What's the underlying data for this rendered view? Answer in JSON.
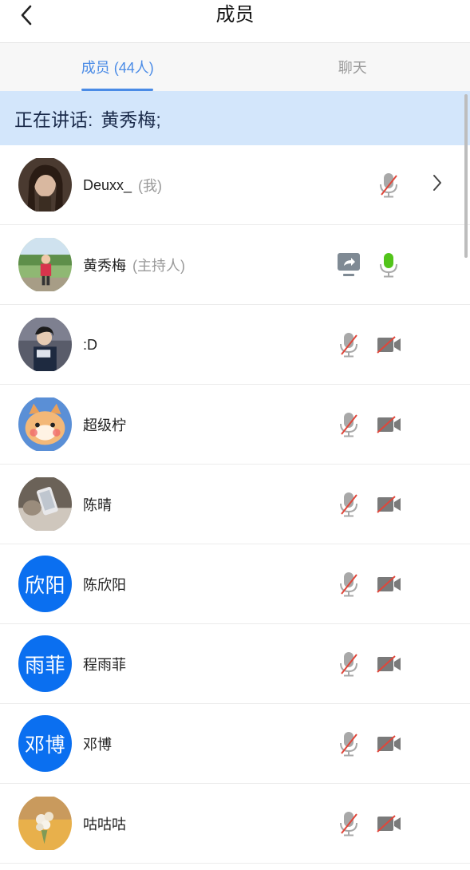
{
  "header": {
    "title": "成员",
    "back_icon": "chevron-left-icon"
  },
  "tabs": [
    {
      "label": "成员 (44人)",
      "active": true
    },
    {
      "label": "聊天",
      "active": false
    }
  ],
  "banner": {
    "prefix": "正在讲话:",
    "speaker": "黄秀梅;"
  },
  "colors": {
    "accent": "#4a8be6",
    "banner_bg": "#d3e6fb",
    "avatar_blue": "#0a6ff0",
    "mic_active": "#52c41a",
    "muted_red": "#e0463a"
  },
  "members": [
    {
      "name": "Deuxx_",
      "role": "(我)",
      "avatar_type": "photo",
      "avatar_icon": "girl-portrait-photo",
      "mic": "muted",
      "video": "none",
      "share": false,
      "chevron": true
    },
    {
      "name": "黄秀梅",
      "role": "(主持人)",
      "avatar_type": "photo",
      "avatar_icon": "child-outdoor-photo",
      "mic": "active",
      "video": "none",
      "share": true,
      "chevron": false
    },
    {
      "name": ":D",
      "role": "",
      "avatar_type": "photo",
      "avatar_icon": "person-indoor-photo",
      "mic": "muted",
      "video": "off",
      "share": false,
      "chevron": false
    },
    {
      "name": "超级柠",
      "role": "",
      "avatar_type": "photo",
      "avatar_icon": "cat-photo",
      "mic": "muted",
      "video": "off",
      "share": false,
      "chevron": false
    },
    {
      "name": "陈晴",
      "role": "",
      "avatar_type": "photo",
      "avatar_icon": "phone-hand-photo",
      "mic": "muted",
      "video": "off",
      "share": false,
      "chevron": false
    },
    {
      "name": "陈欣阳",
      "role": "",
      "avatar_type": "text",
      "avatar_text": "欣阳",
      "mic": "muted",
      "video": "off",
      "share": false,
      "chevron": false
    },
    {
      "name": "程雨菲",
      "role": "",
      "avatar_type": "text",
      "avatar_text": "雨菲",
      "mic": "muted",
      "video": "off",
      "share": false,
      "chevron": false
    },
    {
      "name": "邓博",
      "role": "",
      "avatar_type": "text",
      "avatar_text": "邓博",
      "mic": "muted",
      "video": "off",
      "share": false,
      "chevron": false
    },
    {
      "name": "咕咕咕",
      "role": "",
      "avatar_type": "photo",
      "avatar_icon": "flowers-photo",
      "mic": "muted",
      "video": "off",
      "share": false,
      "chevron": false
    }
  ]
}
